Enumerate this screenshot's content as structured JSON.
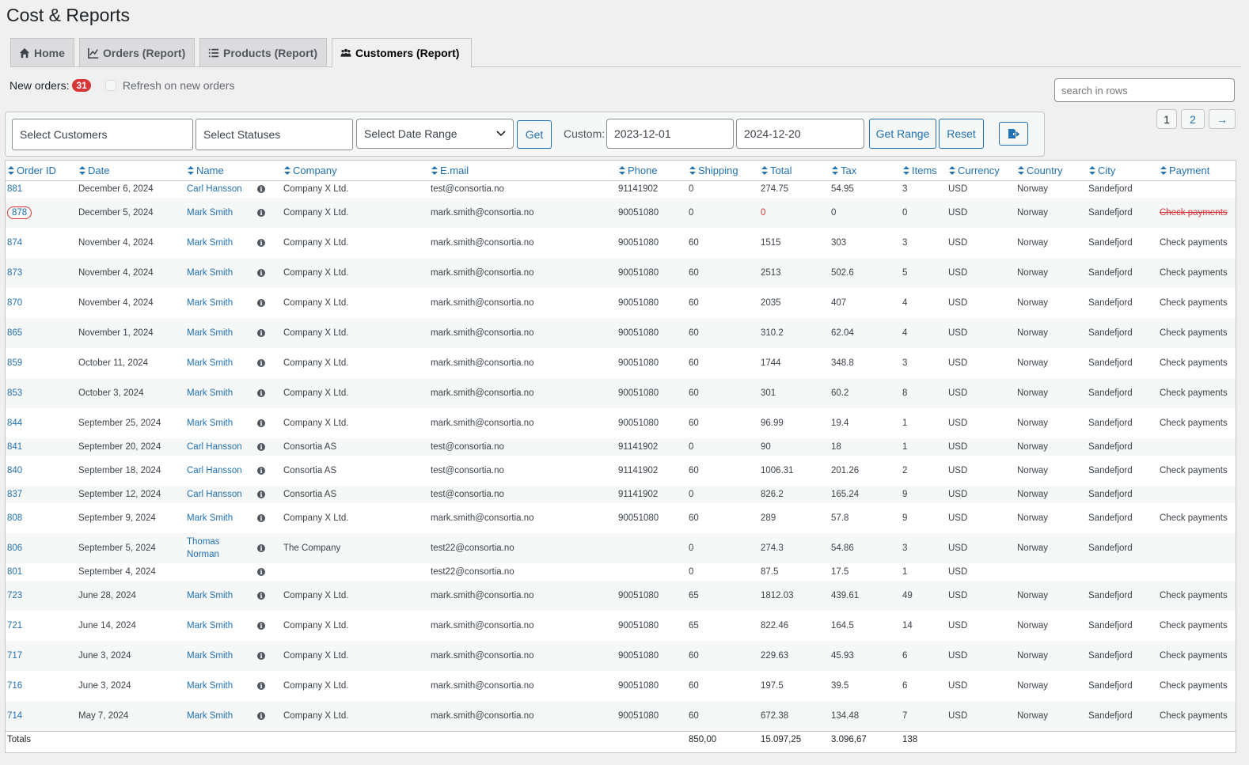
{
  "page_title": "Cost & Reports",
  "tabs": [
    {
      "label": "Home",
      "icon": "home-icon"
    },
    {
      "label": "Orders (Report)",
      "icon": "chart-line-icon"
    },
    {
      "label": "Products (Report)",
      "icon": "list-icon"
    },
    {
      "label": "Customers (Report)",
      "icon": "users-icon",
      "active": true
    }
  ],
  "new_orders": {
    "label": "New orders:",
    "count": "31",
    "refresh_label": "Refresh on new orders"
  },
  "search": {
    "placeholder": "search in rows"
  },
  "filters": {
    "customers_placeholder": "Select Customers",
    "statuses_placeholder": "Select Statuses",
    "date_range": "Select Date Range",
    "get_label": "Get",
    "custom_label": "Custom:",
    "date_from": "2023-12-01",
    "date_to": "2024-12-20",
    "get_range_label": "Get Range",
    "reset_label": "Reset",
    "export_icon": "export-icon"
  },
  "pagination": {
    "pages": [
      "1",
      "2"
    ],
    "next": "→"
  },
  "columns": [
    "Order ID",
    "Date",
    "Name",
    "Company",
    "E.mail",
    "Phone",
    "Shipping",
    "Total",
    "Tax",
    "Items",
    "Currency",
    "Country",
    "City",
    "Payment"
  ],
  "rows": [
    {
      "id": "881",
      "date": "December 6, 2024",
      "name": "Carl Hansson",
      "company": "Company X Ltd.",
      "email": "test@consortia.no",
      "phone": "91141902",
      "shipping": "0",
      "total": "274.75",
      "tax": "54.95",
      "items": "3",
      "currency": "USD",
      "country": "Norway",
      "city": "Sandefjord",
      "payment": ""
    },
    {
      "id": "878",
      "date": "December 5, 2024",
      "name": "Mark Smith",
      "company": "Company X Ltd.",
      "email": "mark.smith@consortia.no",
      "phone": "90051080",
      "shipping": "0",
      "total": "0",
      "tax": "0",
      "items": "0",
      "currency": "USD",
      "country": "Norway",
      "city": "Sandefjord",
      "payment": "Check payments",
      "flag": "cancelled"
    },
    {
      "id": "874",
      "date": "November 4, 2024",
      "name": "Mark Smith",
      "company": "Company X Ltd.",
      "email": "mark.smith@consortia.no",
      "phone": "90051080",
      "shipping": "60",
      "total": "1515",
      "tax": "303",
      "items": "3",
      "currency": "USD",
      "country": "Norway",
      "city": "Sandefjord",
      "payment": "Check payments"
    },
    {
      "id": "873",
      "date": "November 4, 2024",
      "name": "Mark Smith",
      "company": "Company X Ltd.",
      "email": "mark.smith@consortia.no",
      "phone": "90051080",
      "shipping": "60",
      "total": "2513",
      "tax": "502.6",
      "items": "5",
      "currency": "USD",
      "country": "Norway",
      "city": "Sandefjord",
      "payment": "Check payments"
    },
    {
      "id": "870",
      "date": "November 4, 2024",
      "name": "Mark Smith",
      "company": "Company X Ltd.",
      "email": "mark.smith@consortia.no",
      "phone": "90051080",
      "shipping": "60",
      "total": "2035",
      "tax": "407",
      "items": "4",
      "currency": "USD",
      "country": "Norway",
      "city": "Sandefjord",
      "payment": "Check payments"
    },
    {
      "id": "865",
      "date": "November 1, 2024",
      "name": "Mark Smith",
      "company": "Company X Ltd.",
      "email": "mark.smith@consortia.no",
      "phone": "90051080",
      "shipping": "60",
      "total": "310.2",
      "tax": "62.04",
      "items": "4",
      "currency": "USD",
      "country": "Norway",
      "city": "Sandefjord",
      "payment": "Check payments"
    },
    {
      "id": "859",
      "date": "October 11, 2024",
      "name": "Mark Smith",
      "company": "Company X Ltd.",
      "email": "mark.smith@consortia.no",
      "phone": "90051080",
      "shipping": "60",
      "total": "1744",
      "tax": "348.8",
      "items": "3",
      "currency": "USD",
      "country": "Norway",
      "city": "Sandefjord",
      "payment": "Check payments"
    },
    {
      "id": "853",
      "date": "October 3, 2024",
      "name": "Mark Smith",
      "company": "Company X Ltd.",
      "email": "mark.smith@consortia.no",
      "phone": "90051080",
      "shipping": "60",
      "total": "301",
      "tax": "60.2",
      "items": "8",
      "currency": "USD",
      "country": "Norway",
      "city": "Sandefjord",
      "payment": "Check payments"
    },
    {
      "id": "844",
      "date": "September 25, 2024",
      "name": "Mark Smith",
      "company": "Company X Ltd.",
      "email": "mark.smith@consortia.no",
      "phone": "90051080",
      "shipping": "60",
      "total": "96.99",
      "tax": "19.4",
      "items": "1",
      "currency": "USD",
      "country": "Norway",
      "city": "Sandefjord",
      "payment": "Check payments"
    },
    {
      "id": "841",
      "date": "September 20, 2024",
      "name": "Carl Hansson",
      "company": "Consortia AS",
      "email": "test@consortia.no",
      "phone": "91141902",
      "shipping": "0",
      "total": "90",
      "tax": "18",
      "items": "1",
      "currency": "USD",
      "country": "Norway",
      "city": "Sandefjord",
      "payment": ""
    },
    {
      "id": "840",
      "date": "September 18, 2024",
      "name": "Carl Hansson",
      "company": "Consortia AS",
      "email": "test@consortia.no",
      "phone": "91141902",
      "shipping": "60",
      "total": "1006.31",
      "tax": "201.26",
      "items": "2",
      "currency": "USD",
      "country": "Norway",
      "city": "Sandefjord",
      "payment": "Check payments"
    },
    {
      "id": "837",
      "date": "September 12, 2024",
      "name": "Carl Hansson",
      "company": "Consortia AS",
      "email": "test@consortia.no",
      "phone": "91141902",
      "shipping": "0",
      "total": "826.2",
      "tax": "165.24",
      "items": "9",
      "currency": "USD",
      "country": "Norway",
      "city": "Sandefjord",
      "payment": ""
    },
    {
      "id": "808",
      "date": "September 9, 2024",
      "name": "Mark Smith",
      "company": "Company X Ltd.",
      "email": "mark.smith@consortia.no",
      "phone": "90051080",
      "shipping": "60",
      "total": "289",
      "tax": "57.8",
      "items": "9",
      "currency": "USD",
      "country": "Norway",
      "city": "Sandefjord",
      "payment": "Check payments"
    },
    {
      "id": "806",
      "date": "September 5, 2024",
      "name": "Thomas Norman",
      "company": "The Company",
      "email": "test22@consortia.no",
      "phone": "",
      "shipping": "0",
      "total": "274.3",
      "tax": "54.86",
      "items": "3",
      "currency": "USD",
      "country": "Norway",
      "city": "Sandefjord",
      "payment": ""
    },
    {
      "id": "801",
      "date": "September 4, 2024",
      "name": "",
      "company": "",
      "email": "test22@consortia.no",
      "phone": "",
      "shipping": "0",
      "total": "87.5",
      "tax": "17.5",
      "items": "1",
      "currency": "USD",
      "country": "",
      "city": "",
      "payment": ""
    },
    {
      "id": "723",
      "date": "June 28, 2024",
      "name": "Mark Smith",
      "company": "Company X Ltd.",
      "email": "mark.smith@consortia.no",
      "phone": "90051080",
      "shipping": "65",
      "total": "1812.03",
      "tax": "439.61",
      "items": "49",
      "currency": "USD",
      "country": "Norway",
      "city": "Sandefjord",
      "payment": "Check payments"
    },
    {
      "id": "721",
      "date": "June 14, 2024",
      "name": "Mark Smith",
      "company": "Company X Ltd.",
      "email": "mark.smith@consortia.no",
      "phone": "90051080",
      "shipping": "65",
      "total": "822.46",
      "tax": "164.5",
      "items": "14",
      "currency": "USD",
      "country": "Norway",
      "city": "Sandefjord",
      "payment": "Check payments"
    },
    {
      "id": "717",
      "date": "June 3, 2024",
      "name": "Mark Smith",
      "company": "Company X Ltd.",
      "email": "mark.smith@consortia.no",
      "phone": "90051080",
      "shipping": "60",
      "total": "229.63",
      "tax": "45.93",
      "items": "6",
      "currency": "USD",
      "country": "Norway",
      "city": "Sandefjord",
      "payment": "Check payments"
    },
    {
      "id": "716",
      "date": "June 3, 2024",
      "name": "Mark Smith",
      "company": "Company X Ltd.",
      "email": "mark.smith@consortia.no",
      "phone": "90051080",
      "shipping": "60",
      "total": "197.5",
      "tax": "39.5",
      "items": "6",
      "currency": "USD",
      "country": "Norway",
      "city": "Sandefjord",
      "payment": "Check payments"
    },
    {
      "id": "714",
      "date": "May 7, 2024",
      "name": "Mark Smith",
      "company": "Company X Ltd.",
      "email": "mark.smith@consortia.no",
      "phone": "90051080",
      "shipping": "60",
      "total": "672.38",
      "tax": "134.48",
      "items": "7",
      "currency": "USD",
      "country": "Norway",
      "city": "Sandefjord",
      "payment": "Check payments"
    }
  ],
  "totals": {
    "label": "Totals",
    "shipping": "850,00",
    "total": "15.097,25",
    "tax": "3.096,67",
    "items": "138"
  },
  "colors": {
    "link": "#2271b1",
    "alert": "#d63638",
    "border": "#c3c4c7"
  }
}
